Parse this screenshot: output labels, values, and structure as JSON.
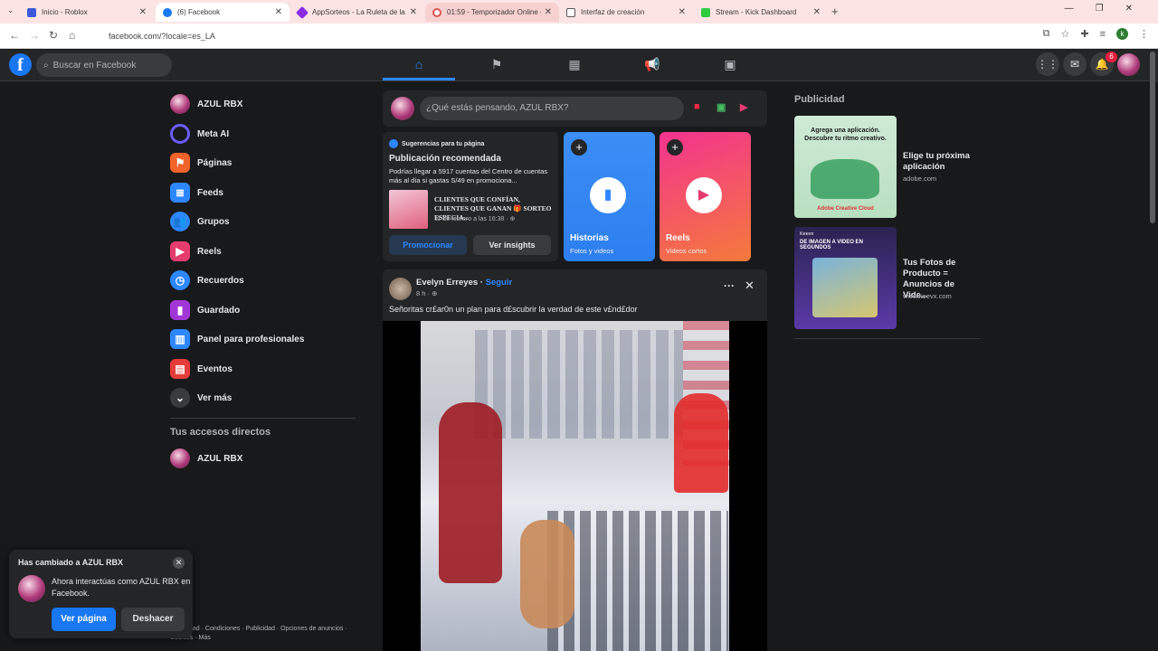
{
  "browser": {
    "tabs": [
      {
        "label": "Inicio - Roblox",
        "color": "#3b5bd9"
      },
      {
        "label": "(6) Facebook",
        "color": "#1877f2"
      },
      {
        "label": "AppSorteos - La Ruleta de la Su",
        "color": "#8a2be2"
      },
      {
        "label": "01:59 - Temporizador Online - I",
        "color": "#d9534f"
      },
      {
        "label": "Interfaz de creación",
        "color": "#555555"
      },
      {
        "label": "Stream - Kick Dashboard",
        "color": "#2ecc40"
      }
    ],
    "new_tab": "+",
    "url": "facebook.com/?locale=es_LA",
    "profile_initial": "k"
  },
  "fb": {
    "logo": "f",
    "search_placeholder": "Buscar en Facebook",
    "notif_count": "6",
    "sidebar": [
      {
        "label": "AZUL RBX",
        "icon": "avatar"
      },
      {
        "label": "Meta AI",
        "icon": "meta-ai-icon",
        "color": "#6a5cff"
      },
      {
        "label": "Páginas",
        "icon": "flag-icon",
        "color": "#f0642c"
      },
      {
        "label": "Feeds",
        "icon": "feeds-icon",
        "color": "#2d88ff"
      },
      {
        "label": "Grupos",
        "icon": "groups-icon",
        "color": "#2d88ff"
      },
      {
        "label": "Reels",
        "icon": "reels-icon",
        "color": "#e63b6f"
      },
      {
        "label": "Recuerdos",
        "icon": "clock-icon",
        "color": "#2d88ff"
      },
      {
        "label": "Guardado",
        "icon": "bookmark-icon",
        "color": "#a235d8"
      },
      {
        "label": "Panel para profesionales",
        "icon": "chart-icon",
        "color": "#2d88ff"
      },
      {
        "label": "Eventos",
        "icon": "calendar-icon",
        "color": "#e63b3b"
      },
      {
        "label": "Ver más",
        "icon": "chevron-down-icon",
        "color": "#3a3b3c"
      }
    ],
    "shortcuts_title": "Tus accesos directos",
    "shortcut": "AZUL RBX",
    "footer": "Privacidad · Condiciones · Publicidad · Opciones de anuncios · Cookies · Más",
    "toast": {
      "title": "Has cambiado a AZUL RBX",
      "body": "Ahora interactúas como AZUL RBX en Facebook.",
      "primary": "Ver página",
      "secondary": "Deshacer"
    },
    "composer_placeholder": "¿Qué estás pensando, AZUL RBX?",
    "suggestion": {
      "header": "Sugerencias para tu página",
      "title": "Publicación recomendada",
      "body": "Podrías llegar a 5917 cuentas del Centro de cuentas más al día si gastas S/49 en promociona...",
      "post_text": "CLIENTES QUE CONFÍAN, CLIENTES QUE GANAN 🎁 SORTEO ESPECIA...",
      "post_date": "11 de febrero a las 16:38 · ",
      "promote": "Promocionar",
      "insights": "Ver insights"
    },
    "stories": [
      {
        "title": "Historias",
        "subtitle": "Fotos y videos"
      },
      {
        "title": "Reels",
        "subtitle": "Videos cortos"
      }
    ],
    "post": {
      "author": "Evelyn Erreyes",
      "follow": "Seguir",
      "time": "8 h · ",
      "text": "Señoritas cr£ar0n un plan para d£scubrir la verdad de este v£nd£dor"
    },
    "ads_title": "Publicidad",
    "ads": [
      {
        "title": "Elige tu próxima aplicación",
        "domain": "adobe.com",
        "image_text": "Agrega una aplicación. Descubre tu ritmo creativo.",
        "image_brand": "Adobe Creative Cloud"
      },
      {
        "title": "Tus Fotos de Producto = Anuncios de Vide...",
        "domain": "www.keevx.com",
        "image_text": "DE IMAGEN A VIDEO EN SEGUNDOS",
        "image_brand": "Keevx"
      }
    ]
  }
}
